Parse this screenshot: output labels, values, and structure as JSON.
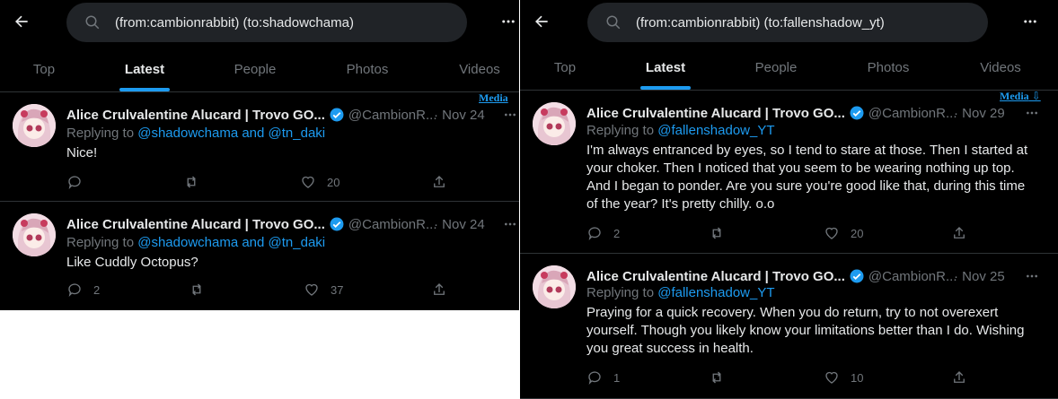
{
  "tabs": [
    "Top",
    "Latest",
    "People",
    "Photos",
    "Videos"
  ],
  "media_link": "Media",
  "left": {
    "query": "(from:cambionrabbit) (to:shadowchama)",
    "tweets": [
      {
        "name": "Alice Crulvalentine Alucard | Trovo GO...",
        "handle": "@CambionR...",
        "date": "· Nov 24",
        "replying_prefix": "Replying to",
        "replying_to": "@shadowchama and @tn_daki",
        "text": "Nice!",
        "replies": "",
        "retweets": "",
        "likes": "20"
      },
      {
        "name": "Alice Crulvalentine Alucard | Trovo GO...",
        "handle": "@CambionR...",
        "date": "· Nov 24",
        "replying_prefix": "Replying to",
        "replying_to": "@shadowchama and @tn_daki",
        "text": "Like Cuddly Octopus?",
        "replies": "2",
        "retweets": "",
        "likes": "37"
      }
    ]
  },
  "right": {
    "query": "(from:cambionrabbit) (to:fallenshadow_yt)",
    "tweets": [
      {
        "name": "Alice Crulvalentine Alucard | Trovo GO...",
        "handle": "@CambionR...",
        "date": "· Nov 29",
        "replying_prefix": "Replying to",
        "replying_to": "@fallenshadow_YT",
        "text": "I'm always entranced by eyes, so I tend to stare at those. Then I started at your choker. Then I noticed that you seem to be wearing nothing up top. And I began to ponder. Are you sure you're good like that, during this time of the year? It's pretty chilly. o.o",
        "replies": "2",
        "retweets": "",
        "likes": "20"
      },
      {
        "name": "Alice Crulvalentine Alucard | Trovo GO...",
        "handle": "@CambionR...",
        "date": "· Nov 25",
        "replying_prefix": "Replying to",
        "replying_to": "@fallenshadow_YT",
        "text": "Praying for a quick recovery. When you do return, try to not overexert yourself. Though you likely know your limitations better than I do. Wishing you great success in health.",
        "replies": "1",
        "retweets": "",
        "likes": "10"
      }
    ]
  },
  "colors": {
    "background": "#000000",
    "accent": "#1d9bf0",
    "text": "#e7e9ea",
    "muted": "#71767b",
    "border": "#2f3336"
  },
  "icons": [
    "back-arrow-icon",
    "search-icon",
    "more-icon",
    "verified-badge-icon",
    "reply-icon",
    "retweet-icon",
    "like-icon",
    "share-icon"
  ]
}
